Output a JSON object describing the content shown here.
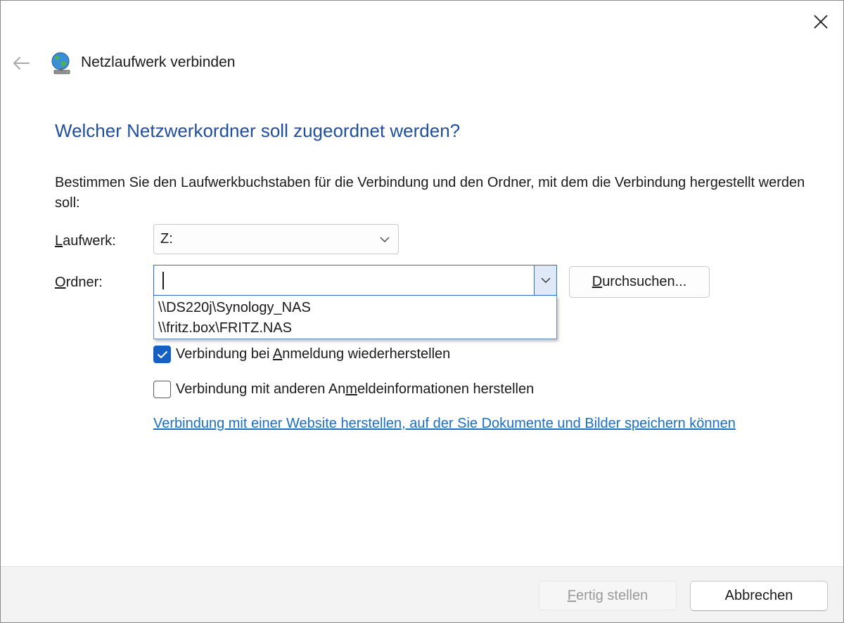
{
  "window": {
    "title": "Netzlaufwerk verbinden"
  },
  "heading": "Welcher Netzwerkordner soll zugeordnet werden?",
  "description": "Bestimmen Sie den Laufwerkbuchstaben für die Verbindung und den Ordner, mit dem die Verbindung hergestellt werden soll:",
  "drive": {
    "label_accel": "L",
    "label_rest": "aufwerk:",
    "value": "Z:"
  },
  "folder": {
    "label_accel": "O",
    "label_rest": "rdner:",
    "value": "",
    "dropdown_items": [
      "\\\\DS220j\\Synology_NAS",
      "\\\\fritz.box\\FRITZ.NAS"
    ]
  },
  "browse_button": {
    "accel": "D",
    "rest": "urchsuchen..."
  },
  "reconnect": {
    "checked": true,
    "pre": "Verbindung bei ",
    "accel": "A",
    "post": "nmeldung wiederherstellen"
  },
  "other_credentials": {
    "checked": false,
    "pre": "Verbindung mit anderen An",
    "accel": "m",
    "post": "eldeinformationen herstellen"
  },
  "web_link": "Verbindung mit einer Website herstellen, auf der Sie Dokumente und Bilder speichern können",
  "footer": {
    "finish_accel": "F",
    "finish_rest": "ertig stellen",
    "cancel_label": "Abbrechen"
  },
  "icons": {
    "close": "close-icon",
    "back": "back-arrow-icon",
    "title": "network-drive-globe-icon",
    "chevron": "chevron-down-icon",
    "check": "checkmark-icon"
  },
  "colors": {
    "heading": "#1f4f9c",
    "accent": "#1660c4",
    "link": "#1a6fc4",
    "focus_border": "#2a6fcf"
  }
}
